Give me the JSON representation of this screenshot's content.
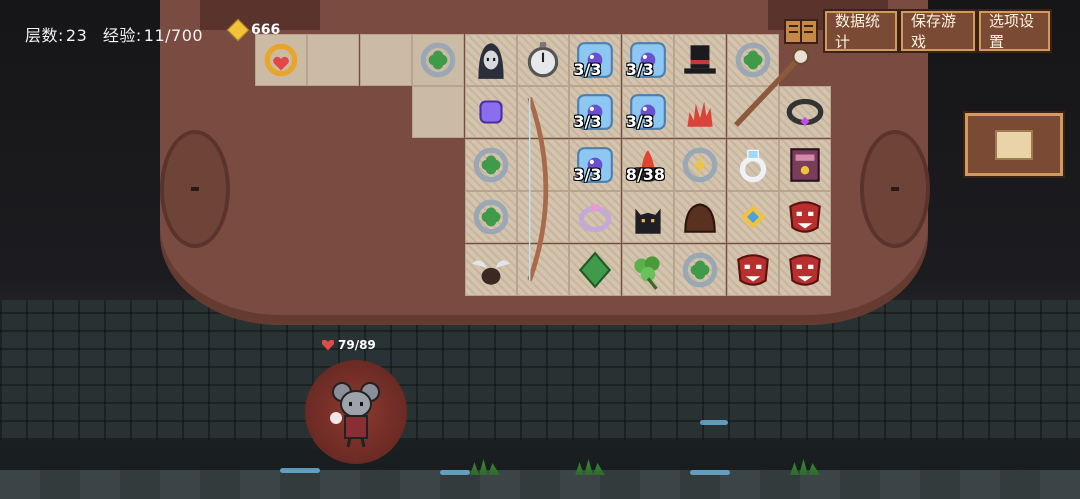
{
  "hud": {
    "floor_label": "层数:",
    "floor_value": "23",
    "exp_label": "经验:",
    "exp_value": "11/700",
    "gold": "666"
  },
  "buttons": {
    "stats": "数据统计",
    "save": "保存游戏",
    "options": "选项设置"
  },
  "hero": {
    "hp": "79/89"
  },
  "bag": {
    "items": [
      {
        "name": "amulet-icon",
        "col": 0,
        "row": 0,
        "counter": ""
      },
      {
        "name": "clover-ring-icon",
        "col": 3,
        "row": 0,
        "counter": ""
      },
      {
        "name": "hooded-figure-icon",
        "col": 4,
        "row": 0,
        "counter": ""
      },
      {
        "name": "stopwatch-icon",
        "col": 5,
        "row": 0,
        "counter": ""
      },
      {
        "name": "ice-orb-icon",
        "col": 6,
        "row": 0,
        "counter": "3/3"
      },
      {
        "name": "ice-orb-icon",
        "col": 7,
        "row": 0,
        "counter": "3/3"
      },
      {
        "name": "top-hat-icon",
        "col": 8,
        "row": 0,
        "counter": ""
      },
      {
        "name": "clover-ring-icon",
        "col": 9,
        "row": 0,
        "counter": ""
      },
      {
        "name": "purple-gem-icon",
        "col": 4,
        "row": 1,
        "counter": ""
      },
      {
        "name": "ice-orb-icon",
        "col": 6,
        "row": 1,
        "counter": "3/3"
      },
      {
        "name": "ice-orb-icon",
        "col": 7,
        "row": 1,
        "counter": "3/3"
      },
      {
        "name": "red-coral-icon",
        "col": 8,
        "row": 1,
        "counter": ""
      },
      {
        "name": "gem-collar-icon",
        "col": 10,
        "row": 1,
        "counter": ""
      },
      {
        "name": "clover-ring-icon",
        "col": 4,
        "row": 2,
        "counter": ""
      },
      {
        "name": "ice-orb-icon",
        "col": 6,
        "row": 2,
        "counter": "3/3"
      },
      {
        "name": "fire-cauldron-icon",
        "col": 7,
        "row": 2,
        "counter": "8/38"
      },
      {
        "name": "lightning-ring-icon",
        "col": 8,
        "row": 2,
        "counter": ""
      },
      {
        "name": "diamond-ring-icon",
        "col": 9,
        "row": 2,
        "counter": ""
      },
      {
        "name": "spellbook-icon",
        "col": 10,
        "row": 2,
        "counter": ""
      },
      {
        "name": "clover-ring-icon",
        "col": 4,
        "row": 3,
        "counter": ""
      },
      {
        "name": "pink-ring-icon",
        "col": 6,
        "row": 3,
        "counter": ""
      },
      {
        "name": "black-cat-icon",
        "col": 7,
        "row": 3,
        "counter": ""
      },
      {
        "name": "leather-bag-icon",
        "col": 8,
        "row": 3,
        "counter": ""
      },
      {
        "name": "gold-amulet-icon",
        "col": 9,
        "row": 3,
        "counter": ""
      },
      {
        "name": "red-mask-icon",
        "col": 10,
        "row": 3,
        "counter": ""
      },
      {
        "name": "winged-boots-icon",
        "col": 4,
        "row": 4,
        "counter": ""
      },
      {
        "name": "green-leaf-icon",
        "col": 6,
        "row": 4,
        "counter": ""
      },
      {
        "name": "herb-bundle-icon",
        "col": 7,
        "row": 4,
        "counter": ""
      },
      {
        "name": "clover-ring-icon",
        "col": 8,
        "row": 4,
        "counter": ""
      },
      {
        "name": "red-mask-icon",
        "col": 9,
        "row": 4,
        "counter": ""
      },
      {
        "name": "red-mask-icon",
        "col": 10,
        "row": 4,
        "counter": ""
      }
    ]
  }
}
